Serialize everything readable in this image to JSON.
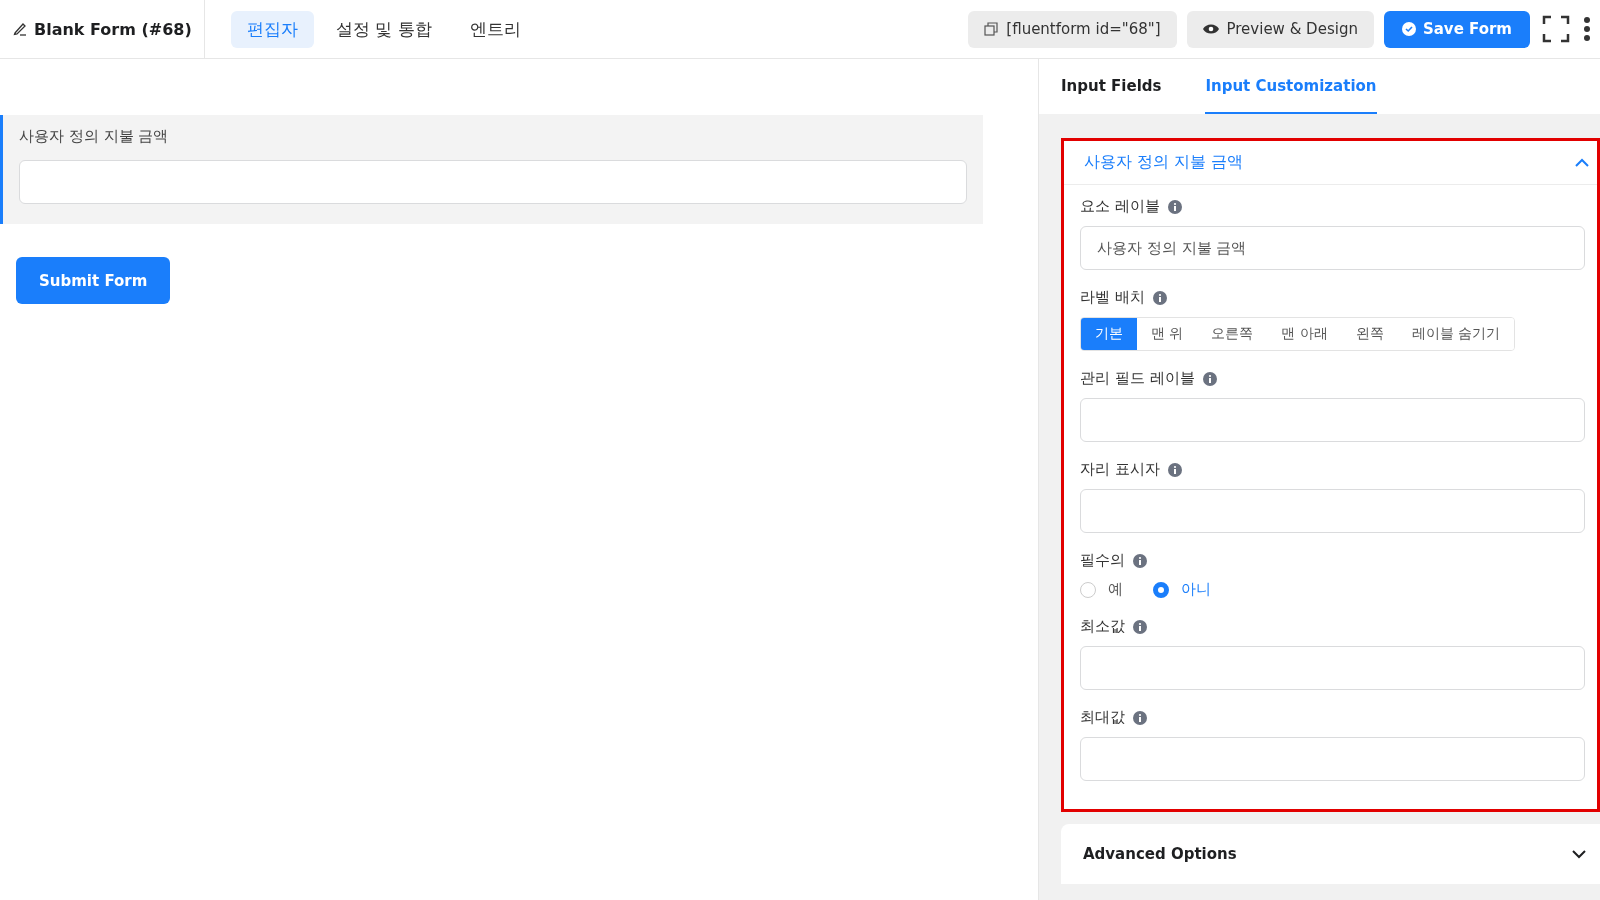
{
  "header": {
    "title": "Blank Form (#68)",
    "tabs": [
      {
        "label": "편집자",
        "selected": true
      },
      {
        "label": "설정 및 통합",
        "selected": false
      },
      {
        "label": "엔트리",
        "selected": false
      }
    ],
    "shortcode": "[fluentform id=\"68\"]",
    "preview_button": "Preview & Design",
    "save_button": "Save Form"
  },
  "canvas": {
    "field_label": "사용자 정의 지불 금액",
    "submit_button": "Submit Form"
  },
  "panel": {
    "tabs": [
      {
        "label": "Input Fields",
        "selected": false
      },
      {
        "label": "Input Customization",
        "selected": true
      }
    ],
    "section_title": "사용자 정의 지불 금액",
    "fields": [
      {
        "kind": "text",
        "label": "요소 레이블",
        "value": "사용자 정의 지불 금액"
      },
      {
        "kind": "segmented",
        "label": "라벨 배치",
        "options": [
          {
            "label": "기본",
            "selected": true
          },
          {
            "label": "맨 위",
            "selected": false
          },
          {
            "label": "오른쪽",
            "selected": false
          },
          {
            "label": "맨 아래",
            "selected": false
          },
          {
            "label": "왼쪽",
            "selected": false
          },
          {
            "label": "레이블 숨기기",
            "selected": false
          }
        ]
      },
      {
        "kind": "text",
        "label": "관리 필드 레이블"
      },
      {
        "kind": "text",
        "label": "자리 표시자"
      },
      {
        "kind": "radio",
        "label": "필수의",
        "options": [
          {
            "label": "예",
            "selected": false
          },
          {
            "label": "아니",
            "selected": true
          }
        ]
      },
      {
        "kind": "text",
        "label": "최소값"
      },
      {
        "kind": "text",
        "label": "최대값"
      }
    ],
    "advanced_title": "Advanced Options"
  }
}
